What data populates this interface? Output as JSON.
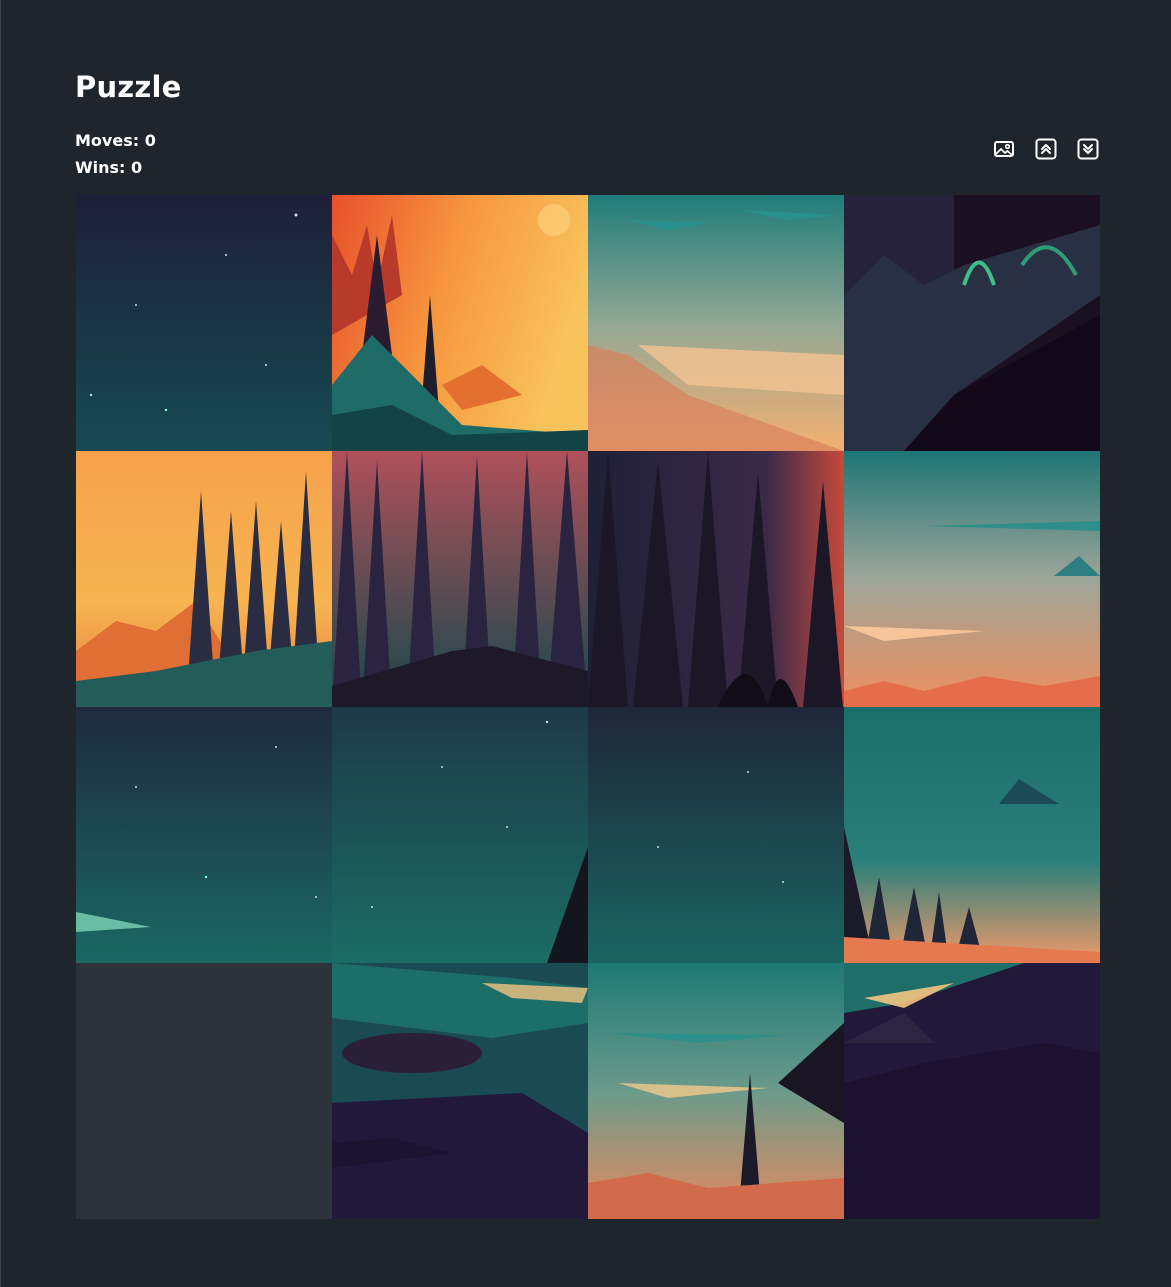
{
  "header": {
    "title": "Puzzle",
    "moves_label": "Moves:",
    "moves": 0,
    "wins_label": "Wins:",
    "wins": 0
  },
  "toolbar": {
    "icons": [
      "image-icon",
      "chevrons-up-icon",
      "chevrons-down-icon"
    ]
  },
  "board": {
    "grid_size": 4,
    "empty_position": [
      3,
      0
    ],
    "palette": {
      "background": "#1f252c",
      "empty_tile": "#2e323b",
      "night_teal": "#1a5a58",
      "sunset_orange": "#f5a24a",
      "deep_purple": "#1c0f24"
    }
  }
}
